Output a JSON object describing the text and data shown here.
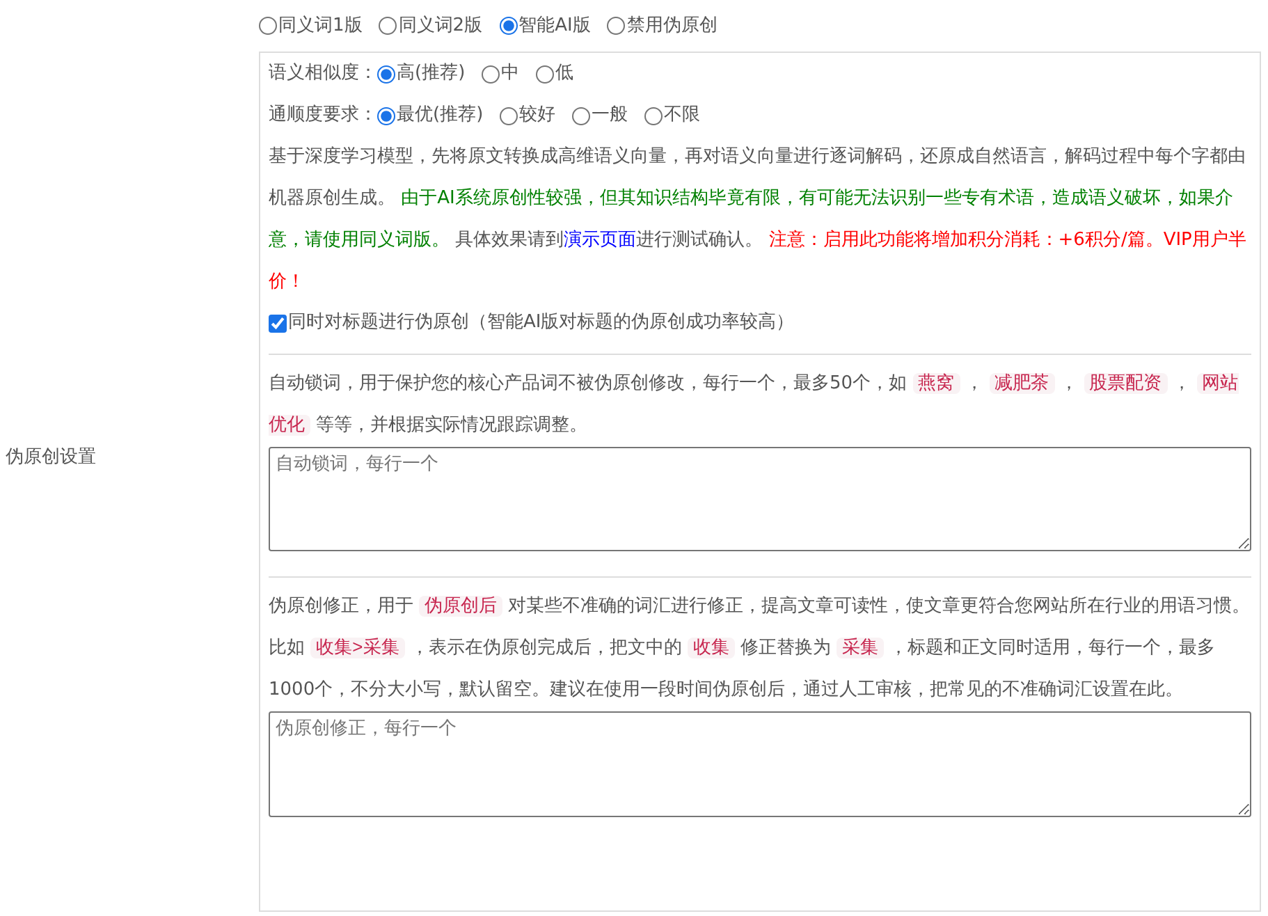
{
  "side_label": "伪原创设置",
  "modes": [
    {
      "label": "同义词1版",
      "selected": false
    },
    {
      "label": "同义词2版",
      "selected": false
    },
    {
      "label": "智能AI版",
      "selected": true
    },
    {
      "label": "禁用伪原创",
      "selected": false
    }
  ],
  "option_groups": [
    {
      "label": "语义相似度：",
      "options": [
        {
          "label": "高(推荐)",
          "selected": true
        },
        {
          "label": "中",
          "selected": false
        },
        {
          "label": "低",
          "selected": false
        }
      ]
    },
    {
      "label": "通顺度要求：",
      "options": [
        {
          "label": "最优(推荐)",
          "selected": true
        },
        {
          "label": "较好",
          "selected": false
        },
        {
          "label": "一般",
          "selected": false
        },
        {
          "label": "不限",
          "selected": false
        }
      ]
    }
  ],
  "description": [
    {
      "kind": "text",
      "text": "基于深度学习模型，先将原文转换成高维语义向量，再对语义向量进行逐词解码，还原成自然语言，解码过程中每个字都由机器原创生成。 "
    },
    {
      "kind": "green",
      "text": "由于AI系统原创性较强，但其知识结构毕竟有限，有可能无法识别一些专有术语，造成语义破坏，如果介意，请使用同义词版。"
    },
    {
      "kind": "text",
      "text": " 具体效果请到"
    },
    {
      "kind": "link",
      "text": "演示页面"
    },
    {
      "kind": "text",
      "text": "进行测试确认。 "
    },
    {
      "kind": "red",
      "text": "注意：启用此功能将增加积分消耗：+6积分/篇。VIP用户半价！"
    }
  ],
  "title_option": {
    "label": "同时对标题进行伪原创（智能AI版对标题的伪原创成功率较高）",
    "checked": true
  },
  "lock_words": {
    "segments": [
      {
        "kind": "text",
        "text": "自动锁词，用于保护您的核心产品词不被伪原创修改，每行一个，最多50个，如"
      },
      {
        "kind": "tag",
        "text": "燕窝"
      },
      {
        "kind": "text",
        "text": "，"
      },
      {
        "kind": "tag",
        "text": "减肥茶"
      },
      {
        "kind": "text",
        "text": "，"
      },
      {
        "kind": "tag",
        "text": "股票配资"
      },
      {
        "kind": "text",
        "text": "，"
      },
      {
        "kind": "tag",
        "text": "网站优化"
      },
      {
        "kind": "text",
        "text": "等等，并根据实际情况跟踪调整。"
      }
    ],
    "placeholder": "自动锁词，每行一个"
  },
  "correction": {
    "segments": [
      {
        "kind": "text",
        "text": "伪原创修正，用于"
      },
      {
        "kind": "tag",
        "text": "伪原创后"
      },
      {
        "kind": "text",
        "text": "对某些不准确的词汇进行修正，提高文章可读性，使文章更符合您网站所在行业的用语习惯。比如"
      },
      {
        "kind": "tag",
        "text": "收集>采集"
      },
      {
        "kind": "text",
        "text": "，表示在伪原创完成后，把文中的"
      },
      {
        "kind": "tag",
        "text": "收集"
      },
      {
        "kind": "text",
        "text": "修正替换为"
      },
      {
        "kind": "tag",
        "text": "采集"
      },
      {
        "kind": "text",
        "text": "，标题和正文同时适用，每行一个，最多1000个，不分大小写，默认留空。建议在使用一段时间伪原创后，通过人工审核，把常见的不准确词汇设置在此。"
      }
    ],
    "placeholder": "伪原创修正，每行一个"
  }
}
